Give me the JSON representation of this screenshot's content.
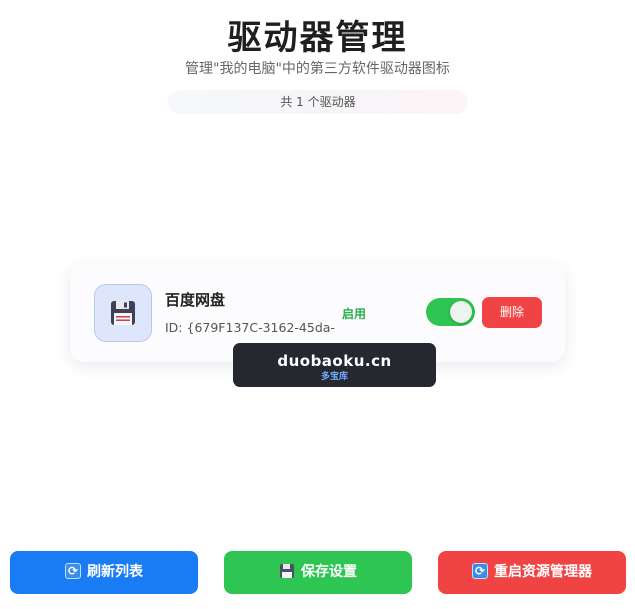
{
  "header": {
    "title": "驱动器管理",
    "subtitle": "管理\"我的电脑\"中的第三方软件驱动器图标",
    "count_label": "共 1 个驱动器"
  },
  "drives": [
    {
      "name": "百度网盘",
      "id": "ID: {679F137C-3162-45da-",
      "status": "启用",
      "enabled": true,
      "delete_label": "删除",
      "icon": "floppy-disk-icon"
    }
  ],
  "watermark": {
    "main": "duobaoku.cn",
    "sub": "多宝库"
  },
  "footer": {
    "refresh_label": "刷新列表",
    "save_label": "保存设置",
    "restart_label": "重启资源管理器"
  },
  "colors": {
    "primary": "#1a7cf4",
    "success": "#2fc553",
    "danger": "#f04444",
    "status_text": "#27b04a"
  }
}
